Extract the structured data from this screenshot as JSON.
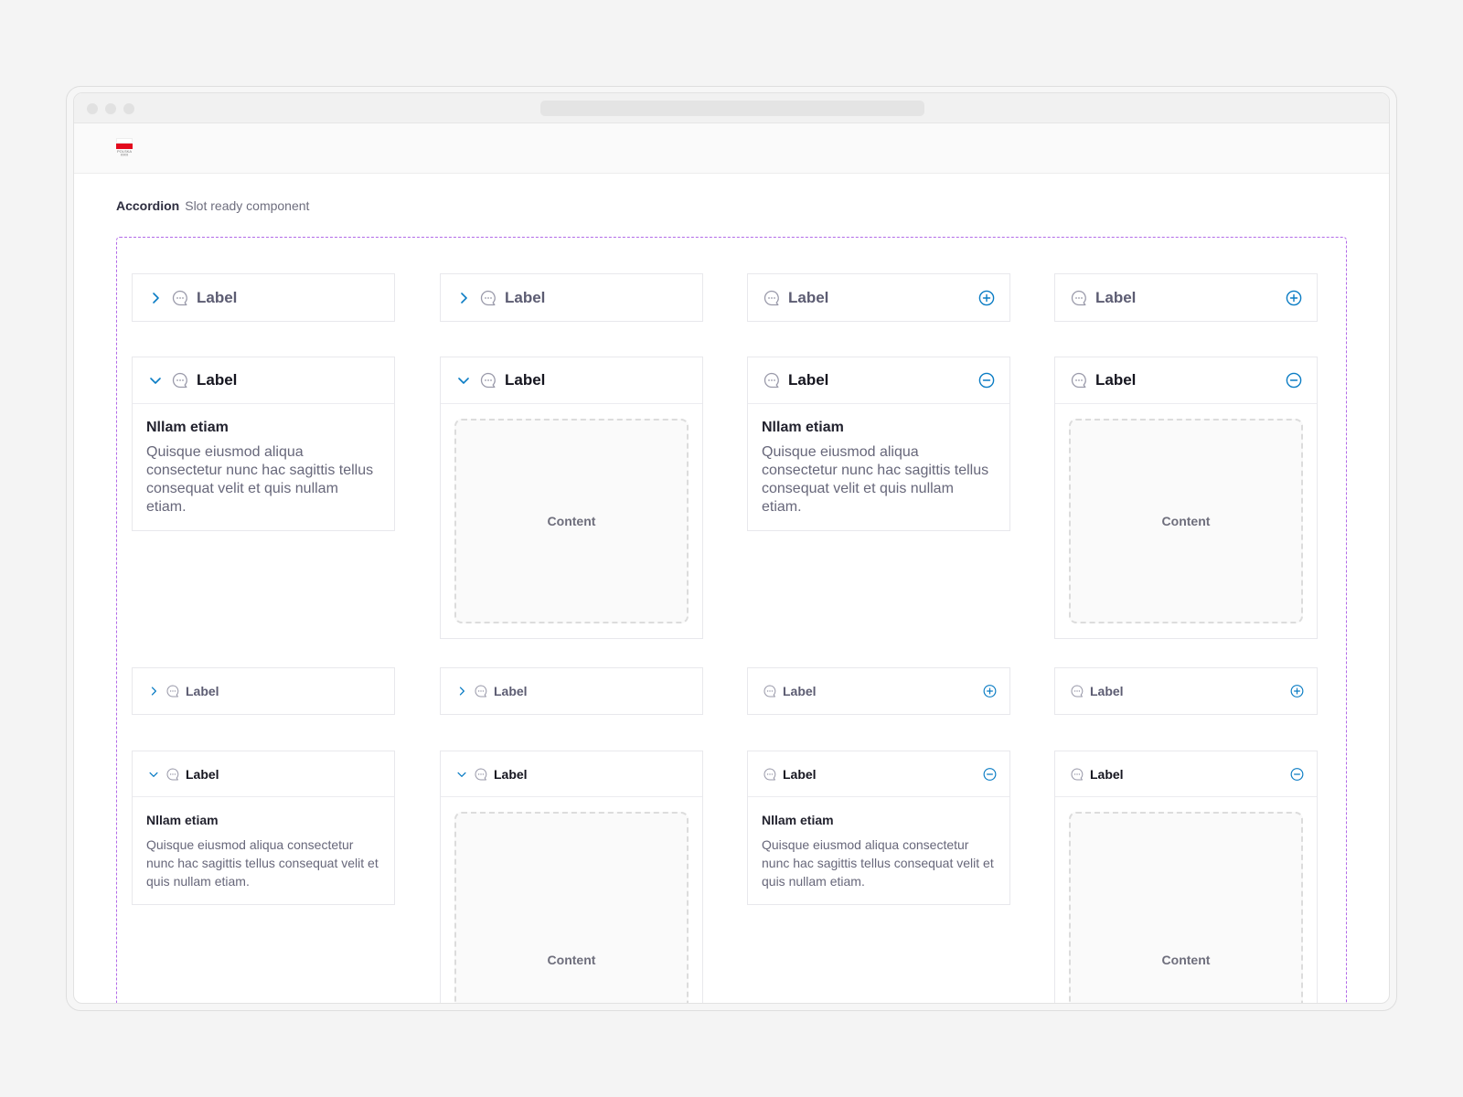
{
  "page": {
    "title": "Accordion",
    "subtitle": "Slot ready component"
  },
  "logo": {
    "text": "POLSKA",
    "icon": "olympic-rings-icon"
  },
  "colors": {
    "accent": "#0a7cc4",
    "slot_border": "#b36be8",
    "label_closed": "#5c5c72",
    "label_open": "#15151f"
  },
  "icons": {
    "closed_left": "chevron-right-icon",
    "open_left": "chevron-down-icon",
    "closed_right": "plus-circle-icon",
    "open_right": "minus-circle-icon",
    "item": "chat-bubble-icon"
  },
  "accordion": {
    "label": "Label",
    "body_title": "Nllam etiam",
    "body_text_large": "Quisque eiusmod aliqua consectetur nunc hac sagittis tellus consequat velit et quis nullam etiam.",
    "body_text_small": "Quisque eiusmod aliqua consectetur nunc hac sagittis tellus consequat velit et quis nullam etiam.",
    "slot_text": "Content"
  }
}
